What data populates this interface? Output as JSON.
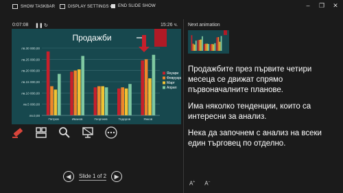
{
  "toolbar": {
    "show_taskbar": "SHOW TASKBAR",
    "display_settings": "DISPLAY SETTINGS ▾",
    "end_show": "END SLIDE SHOW"
  },
  "timer": {
    "elapsed": "0:07:08",
    "pause": "❚❚",
    "reset": "↻",
    "clock": "15:26 ч."
  },
  "next_animation": {
    "label": "Next animation"
  },
  "navigation": {
    "prev": "◀",
    "counter": "Slide 1 of 2",
    "next": "▶"
  },
  "notes": {
    "p1": "Продажбите през първите четири месеца се движат спрямо първоначалните планове.",
    "p2": "Има няколко тенденции, които са интересни за анализ.",
    "p3": "Нека да започнем с анализ на всеки един търговец по отделно."
  },
  "font_controls": {
    "increase": "A",
    "decrease": "A"
  },
  "colors": {
    "jan": "#c8202b",
    "feb": "#f0862a",
    "mar": "#f1c232",
    "apr": "#7fc8a1"
  },
  "chart_data": {
    "type": "bar",
    "title": "Продажби",
    "categories": [
      "Петров",
      "Иванов",
      "Георгиев",
      "Тодоров",
      "Янков"
    ],
    "series": [
      {
        "name": "Януари",
        "values": [
          28500,
          19500,
          12500,
          12000,
          24500
        ]
      },
      {
        "name": "Февруари",
        "values": [
          13000,
          20000,
          13000,
          12500,
          25000
        ]
      },
      {
        "name": "Март",
        "values": [
          11500,
          20500,
          13000,
          12000,
          16500
        ]
      },
      {
        "name": "Април",
        "values": [
          18500,
          26500,
          12500,
          14000,
          27000
        ]
      }
    ],
    "yticks": [
      "лв.30 000,00",
      "лв.25 000,00",
      "лв.20 000,00",
      "лв.15 000,00",
      "лв.10 000,00",
      "лв.5 000,00",
      "лв.0,00"
    ],
    "ylim": [
      0,
      30000
    ],
    "legend": "right"
  }
}
